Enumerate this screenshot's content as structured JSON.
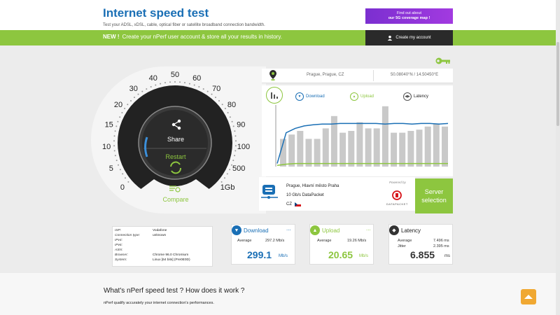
{
  "header": {
    "title": "Internet speed test",
    "subtitle": "Test your ADSL, xDSL, cable, optical fiber or satellite broadband connection bandwidth.",
    "promo_line1": "Find out about",
    "promo_line2": "our 5G coverage map !"
  },
  "banner": {
    "new_label": "NEW !",
    "text": "Create your nPerf user account & store all your results in history.",
    "create_account": "Create my account"
  },
  "gauge": {
    "ticks": [
      "0",
      "5",
      "10",
      "15",
      "20",
      "30",
      "40",
      "50",
      "60",
      "70",
      "80",
      "90",
      "100",
      "500",
      "1Gb"
    ],
    "share_label": "Share",
    "restart_label": "Restart",
    "compare_label": "Compare"
  },
  "location": {
    "city": "Prague, Prague, CZ",
    "coords": "50.08040°N / 14.50450°E"
  },
  "legend": {
    "download": "Download",
    "upload": "Upload",
    "latency": "Latency"
  },
  "chart_data": {
    "type": "bar",
    "series": [
      {
        "name": "Download",
        "values": [
          0.05,
          0.55,
          0.62,
          0.66,
          0.68,
          0.69,
          0.69,
          0.7,
          0.7,
          0.7,
          0.7,
          0.7,
          0.69,
          0.7,
          0.7,
          0.69,
          0.7,
          0.7,
          0.69,
          0.7
        ]
      },
      {
        "name": "Upload",
        "values": [
          0.02,
          0.04,
          0.05,
          0.05,
          0.05,
          0.05,
          0.05,
          0.05,
          0.05,
          0.05,
          0.05,
          0.05,
          0.05,
          0.05,
          0.05,
          0.05,
          0.05,
          0.05,
          0.05,
          0.05
        ]
      }
    ],
    "bars": [
      0.45,
      0.52,
      0.58,
      0.45,
      0.45,
      0.62,
      0.82,
      0.55,
      0.58,
      0.72,
      0.62,
      0.62,
      0.98,
      0.55,
      0.55,
      0.58,
      0.6,
      0.65,
      0.7,
      0.65
    ]
  },
  "server": {
    "city": "Prague, Hlavní město Praha",
    "provider": "10 Gb/s DataPacket",
    "country": "CZ",
    "powered_by": "Powered by",
    "brand": "DATAPACKET",
    "select_label_1": "Server",
    "select_label_2": "selection"
  },
  "info": {
    "rows": [
      {
        "k": "ISP:",
        "v": "Vodafone"
      },
      {
        "k": "Connection type:",
        "v": "unknown"
      },
      {
        "k": "IPv4:",
        "v": ""
      },
      {
        "k": "IPv6:",
        "v": ""
      },
      {
        "k": "ASN:",
        "v": ""
      },
      {
        "k": "Browser:",
        "v": "Chrome 96.0 Chromium"
      },
      {
        "k": "System:",
        "v": "Linux [64 bits] (Pre0E0D)"
      }
    ]
  },
  "download": {
    "title": "Download",
    "more": "...",
    "avg_label": "Average",
    "avg_value": "297.2 Mb/s",
    "value": "299.1",
    "unit": "Mb/s",
    "color": "#1a6fb5"
  },
  "upload": {
    "title": "Upload",
    "more": "...",
    "avg_label": "Average",
    "avg_value": "19.26 Mb/s",
    "value": "20.65",
    "unit": "Mb/s",
    "color": "#8dc63f"
  },
  "latency": {
    "title": "Latency",
    "avg_label": "Average",
    "avg_value": "7.496 ms",
    "jitter_label": "Jitter",
    "jitter_value": "2.395 ms",
    "value": "6.855",
    "unit": "ms",
    "color": "#333333"
  },
  "bottom": {
    "title": "What's nPerf speed test ? How does it work ?",
    "text": "nPerf qualify accurately your internet connection's performances."
  }
}
